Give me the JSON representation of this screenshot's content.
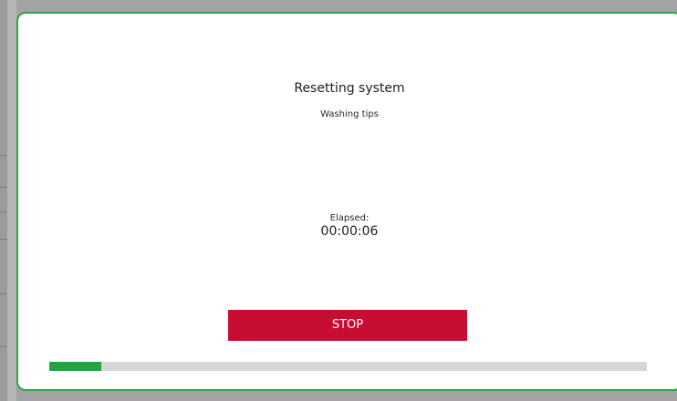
{
  "dialog": {
    "title": "Resetting system",
    "subtitle": "Washing tips",
    "elapsed_label": "Elapsed:",
    "elapsed_value": "00:00:06",
    "stop_label": "STOP",
    "progress_fraction": 0.087
  },
  "colors": {
    "border": "#2ea84a",
    "stop_button": "#c70d31",
    "progress_fill": "#23a342",
    "progress_track": "#d6d6d6"
  }
}
